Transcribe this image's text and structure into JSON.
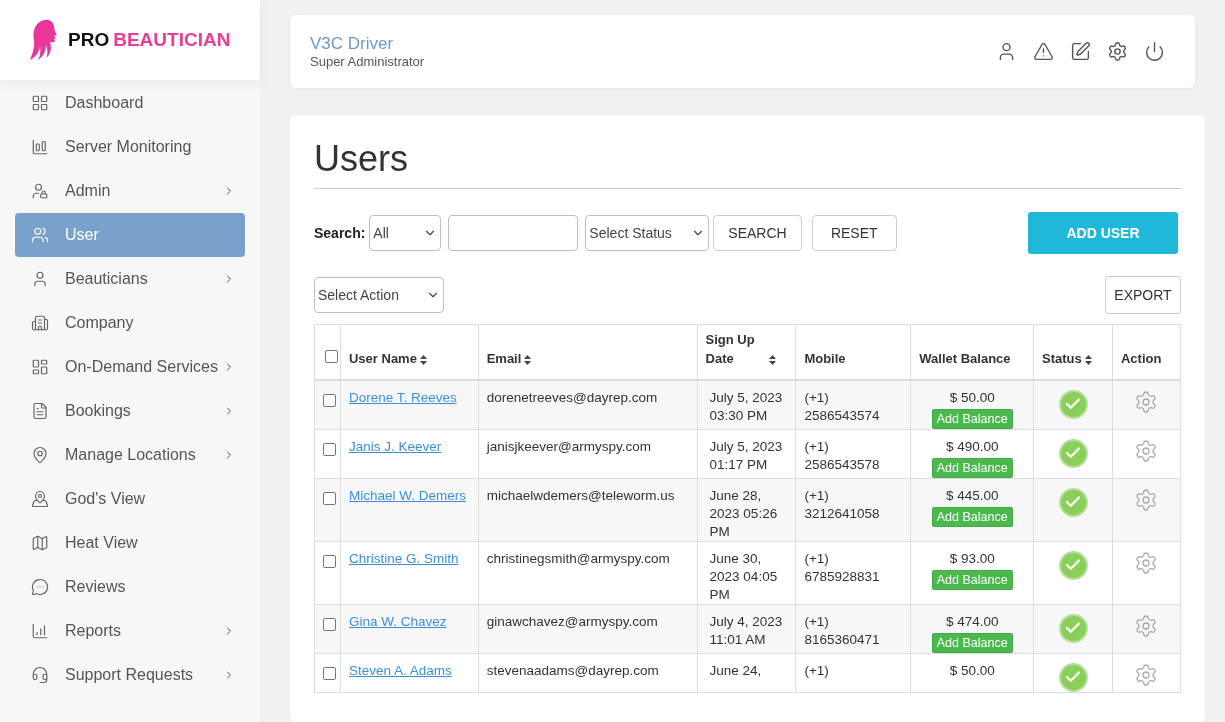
{
  "brand": {
    "part_1": "PRO",
    "part_2": "BEAUTICIAN"
  },
  "sidebar": {
    "items": [
      {
        "label": "Dashboard",
        "selected": false,
        "has_submenu": false
      },
      {
        "label": "Server Monitoring",
        "selected": false,
        "has_submenu": false
      },
      {
        "label": "Admin",
        "selected": false,
        "has_submenu": true
      },
      {
        "label": "User",
        "selected": true,
        "has_submenu": false
      },
      {
        "label": "Beauticians",
        "selected": false,
        "has_submenu": true
      },
      {
        "label": "Company",
        "selected": false,
        "has_submenu": false
      },
      {
        "label": "On-Demand Services",
        "selected": false,
        "has_submenu": true
      },
      {
        "label": "Bookings",
        "selected": false,
        "has_submenu": true
      },
      {
        "label": "Manage Locations",
        "selected": false,
        "has_submenu": true
      },
      {
        "label": "God's View",
        "selected": false,
        "has_submenu": false
      },
      {
        "label": "Heat View",
        "selected": false,
        "has_submenu": false
      },
      {
        "label": "Reviews",
        "selected": false,
        "has_submenu": false
      },
      {
        "label": "Reports",
        "selected": false,
        "has_submenu": true
      },
      {
        "label": "Support Requests",
        "selected": false,
        "has_submenu": true
      }
    ]
  },
  "header": {
    "user_name": "V3C Driver",
    "role": "Super Administrator"
  },
  "page": {
    "title": "Users",
    "search": {
      "label": "Search:",
      "field_select": "All",
      "status_select": "Select Status",
      "search_button": "SEARCH",
      "reset_button": "RESET"
    },
    "add_button": "ADD USER",
    "action_select": "Select Action",
    "export_button": "EXPORT"
  },
  "table": {
    "select_all_checked": false,
    "columns": [
      {
        "label": "User Name",
        "sortable": true
      },
      {
        "label": "Email",
        "sortable": true
      },
      {
        "label": "Sign Up Date",
        "sortable": true
      },
      {
        "label": "Mobile",
        "sortable": false
      },
      {
        "label": "Wallet Balance",
        "sortable": false
      },
      {
        "label": "Status",
        "sortable": true
      },
      {
        "label": "Action",
        "sortable": false
      }
    ],
    "rows": [
      {
        "checked": false,
        "name": "Dorene T. Reeves",
        "email": "dorenetreeves@dayrep.com",
        "date": "July 5, 2023 03:30 PM",
        "mobile_code": "(+1)",
        "mobile": "2586543574",
        "balance": "$ 50.00",
        "add_balance": "Add Balance",
        "active": true
      },
      {
        "checked": false,
        "name": "Janis J. Keever",
        "email": "janisjkeever@armyspy.com",
        "date": "July 5, 2023 01:17 PM",
        "mobile_code": "(+1)",
        "mobile": "2586543578",
        "balance": "$ 490.00",
        "add_balance": "Add Balance",
        "active": true
      },
      {
        "checked": false,
        "name": "Michael W. Demers",
        "email": "michaelwdemers@teleworm.us",
        "date": "June 28, 2023 05:26 PM",
        "mobile_code": "(+1)",
        "mobile": "3212641058",
        "balance": "$ 445.00",
        "add_balance": "Add Balance",
        "active": true
      },
      {
        "checked": false,
        "name": "Christine G. Smith",
        "email": "christinegsmith@armyspy.com",
        "date": "June 30, 2023 04:05 PM",
        "mobile_code": "(+1)",
        "mobile": "6785928831",
        "balance": "$ 93.00",
        "add_balance": "Add Balance",
        "active": true
      },
      {
        "checked": false,
        "name": "Gina W. Chavez",
        "email": "ginawchavez@armyspy.com",
        "date": "July 4, 2023 11:01 AM",
        "mobile_code": "(+1)",
        "mobile": "8165360471",
        "balance": "$ 474.00",
        "add_balance": "Add Balance",
        "active": true
      },
      {
        "checked": false,
        "name": "Steven A. Adams",
        "email": "stevenaadams@dayrep.com",
        "date": "June 24,",
        "mobile_code": "(+1)",
        "balance": "$ 50.00",
        "active": true
      }
    ]
  }
}
